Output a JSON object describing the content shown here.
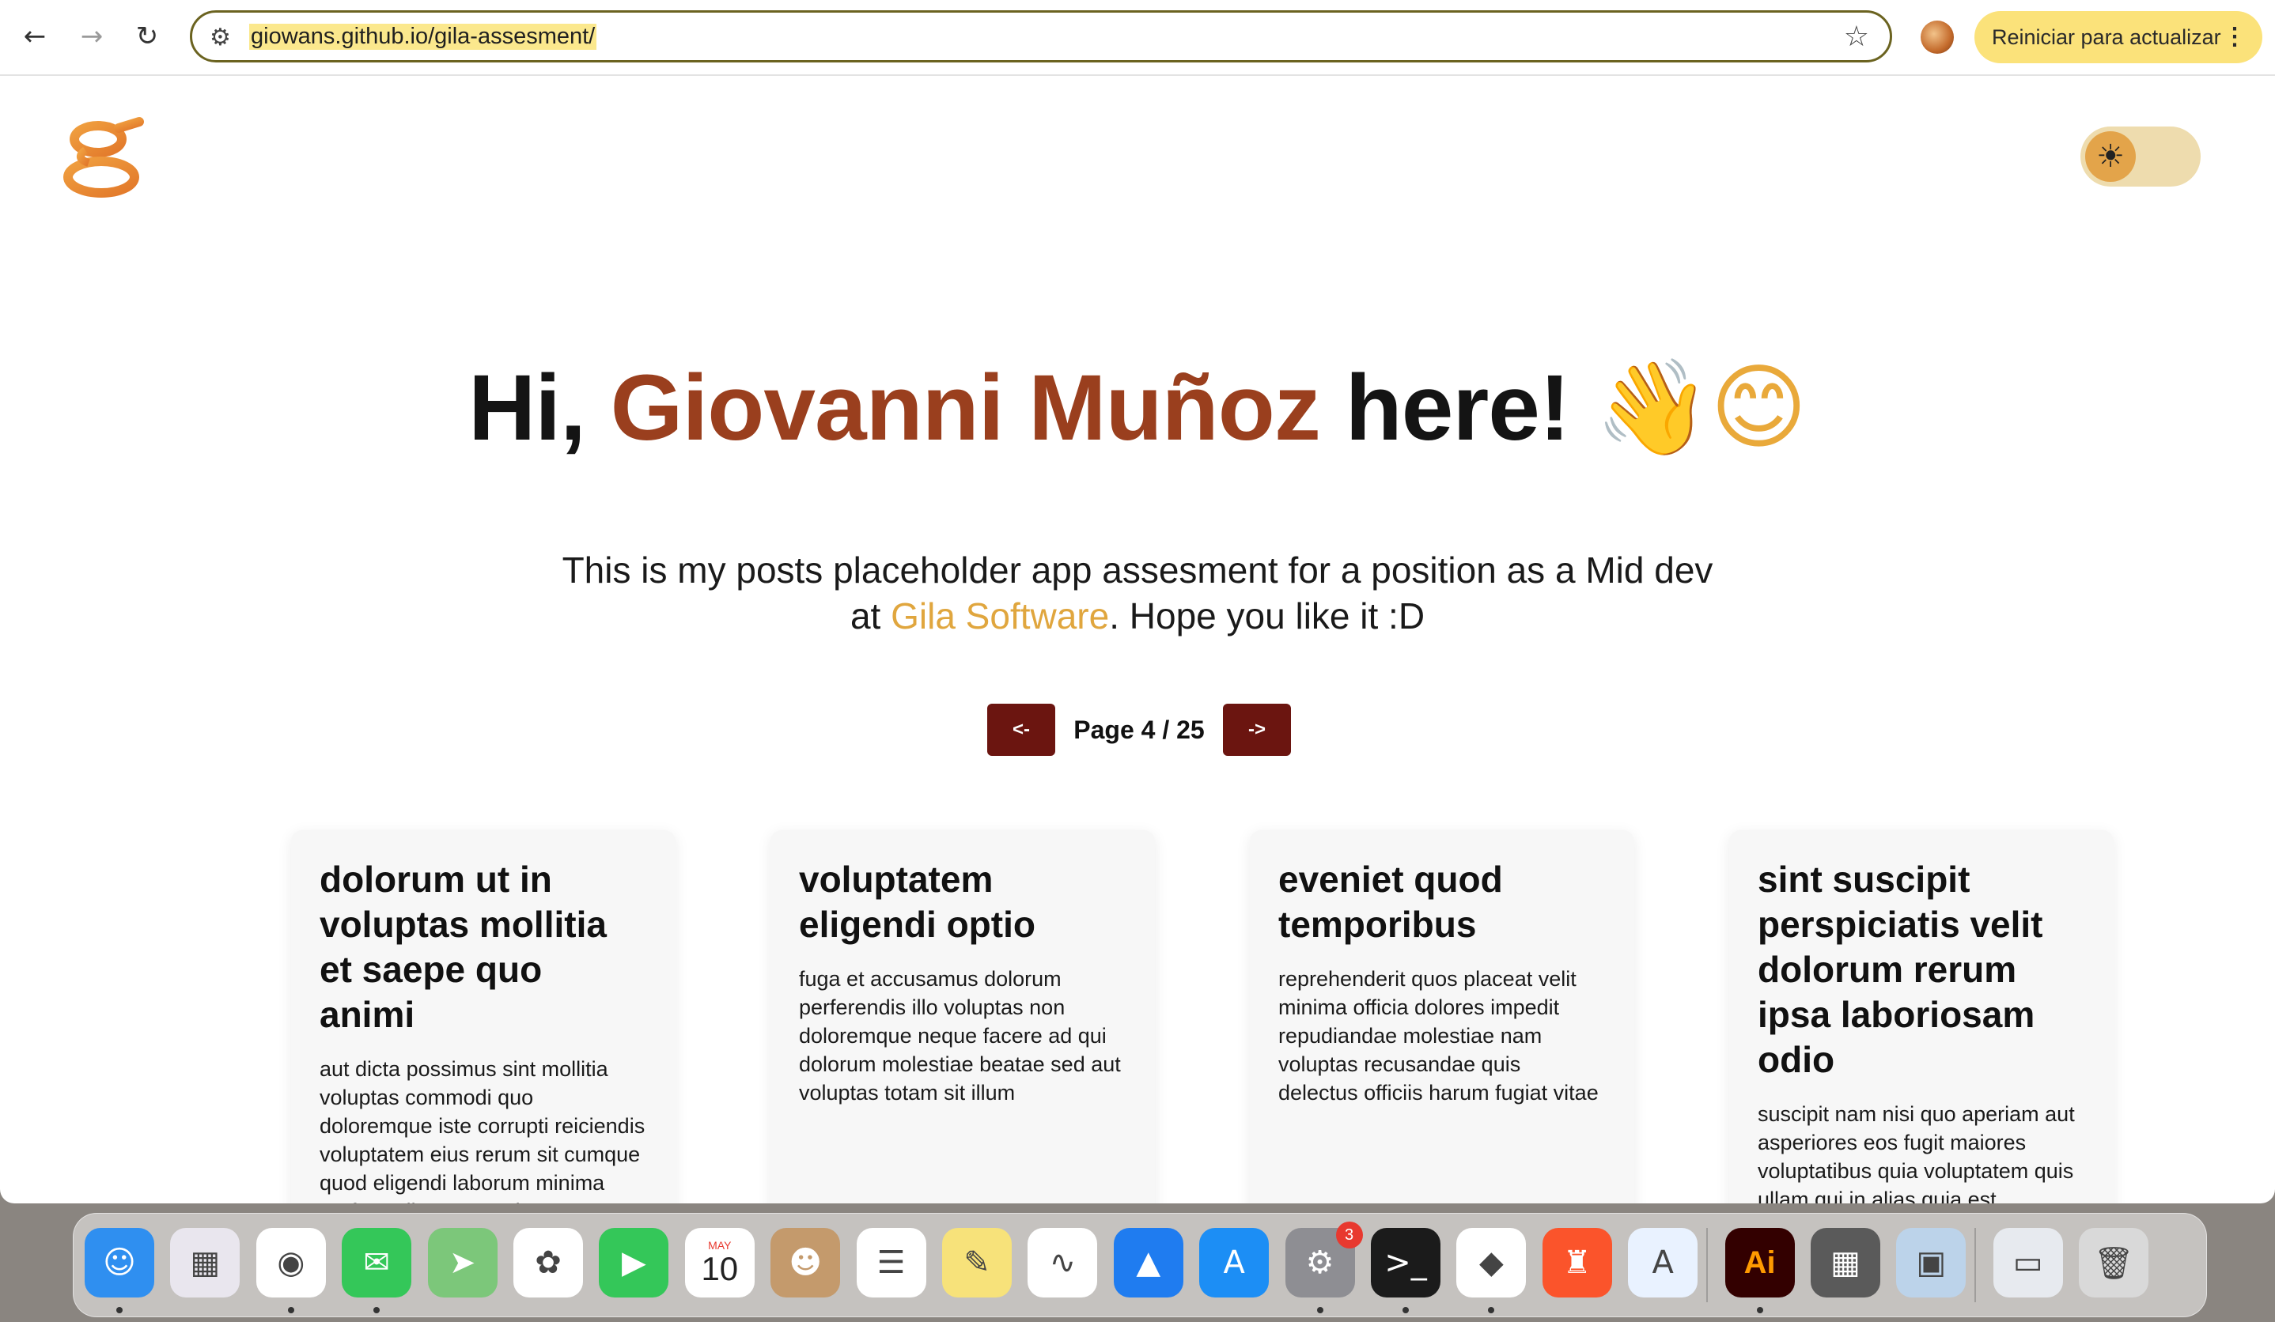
{
  "browser": {
    "url": "giowans.github.io/gila-assesment/",
    "update_label": "Reiniciar para actualizar",
    "more_glyph": "⋮",
    "back_glyph": "←",
    "forward_glyph": "→",
    "reload_glyph": "↻",
    "star_glyph": "☆",
    "site_info_glyph": "⚙"
  },
  "header": {
    "logo_letter": "g",
    "theme_icon": "sun-icon",
    "theme_glyph": "☀"
  },
  "hero": {
    "greeting": "Hi,",
    "name": "Giovanni Muñoz",
    "suffix": "here!",
    "emoji": "👋😊"
  },
  "intro": {
    "text_before": "This is my posts placeholder app assesment for a position as a Mid dev at ",
    "company": "Gila Software",
    "text_after": ". Hope you like it :D"
  },
  "pagination": {
    "prev_label": "<-",
    "next_label": "->",
    "page_label": "Page 4 / 25"
  },
  "posts": [
    {
      "title": "dolorum ut in voluptas mollitia et saepe quo animi",
      "body": "aut dicta possimus sint mollitia voluptas commodi quo doloremque iste corrupti reiciendis voluptatem eius rerum sit cumque quod eligendi laborum minima perferendis recusandae assumenda"
    },
    {
      "title": "voluptatem eligendi optio",
      "body": "fuga et accusamus dolorum perferendis illo voluptas non doloremque neque facere ad qui dolorum molestiae beatae sed aut voluptas totam sit illum"
    },
    {
      "title": "eveniet quod temporibus",
      "body": "reprehenderit quos placeat velit minima officia dolores impedit repudiandae molestiae nam voluptas recusandae quis delectus officiis harum fugiat vitae"
    },
    {
      "title": "sint suscipit perspiciatis velit dolorum rerum ipsa laboriosam odio",
      "body": "suscipit nam nisi quo aperiam aut asperiores eos fugit maiores voluptatibus quia voluptatem quis ullam qui in alias quia est"
    }
  ],
  "dock": {
    "apps": [
      {
        "name": "finder",
        "glyph": "☺",
        "color": "#2f8ff0",
        "running": true
      },
      {
        "name": "launchpad",
        "glyph": "▦",
        "color": "#e9e6ee",
        "running": false
      },
      {
        "name": "chrome",
        "glyph": "◉",
        "color": "#ffffff",
        "running": true
      },
      {
        "name": "messages",
        "glyph": "✉",
        "color": "#34c759",
        "running": true
      },
      {
        "name": "maps",
        "glyph": "➤",
        "color": "#7cc77a",
        "running": false
      },
      {
        "name": "photos",
        "glyph": "✿",
        "color": "#ffffff",
        "running": false
      },
      {
        "name": "facetime",
        "glyph": "▶",
        "color": "#34c759",
        "running": false
      },
      {
        "name": "calendar",
        "glyph": "10",
        "color": "#ffffff",
        "running": false
      },
      {
        "name": "contacts",
        "glyph": "☻",
        "color": "#c49a6c",
        "running": false
      },
      {
        "name": "reminders",
        "glyph": "☰",
        "color": "#ffffff",
        "running": false
      },
      {
        "name": "notes",
        "glyph": "✎",
        "color": "#f7e27a",
        "running": false
      },
      {
        "name": "freeform",
        "glyph": "∿",
        "color": "#ffffff",
        "running": false
      },
      {
        "name": "keynote",
        "glyph": "▲",
        "color": "#1f7cf0",
        "running": false
      },
      {
        "name": "app-store",
        "glyph": "A",
        "color": "#1c8ef5",
        "running": false
      },
      {
        "name": "system-settings",
        "glyph": "⚙",
        "color": "#8e8e93",
        "running": true,
        "badge": "3"
      },
      {
        "name": "terminal",
        "glyph": ">_",
        "color": "#1b1b1b",
        "running": true
      },
      {
        "name": "vscode",
        "glyph": "◆",
        "color": "#ffffff",
        "running": true
      },
      {
        "name": "brave",
        "glyph": "♜",
        "color": "#fb542b",
        "running": false
      },
      {
        "name": "xcode-instruments",
        "glyph": "A",
        "color": "#e9f2ff",
        "running": false
      },
      {
        "name": "illustrator",
        "glyph": "Ai",
        "color": "#330000",
        "running": true
      },
      {
        "name": "calculator",
        "glyph": "▦",
        "color": "#5a5a5a",
        "running": false
      },
      {
        "name": "preview",
        "glyph": "▣",
        "color": "#bcd3ea",
        "running": false
      },
      {
        "name": "window-stack",
        "glyph": "▭",
        "color": "#e7eaef",
        "running": false
      },
      {
        "name": "trash",
        "glyph": "🗑",
        "color": "#d9d9d9",
        "running": false
      }
    ],
    "calendar_month": "MAY"
  }
}
